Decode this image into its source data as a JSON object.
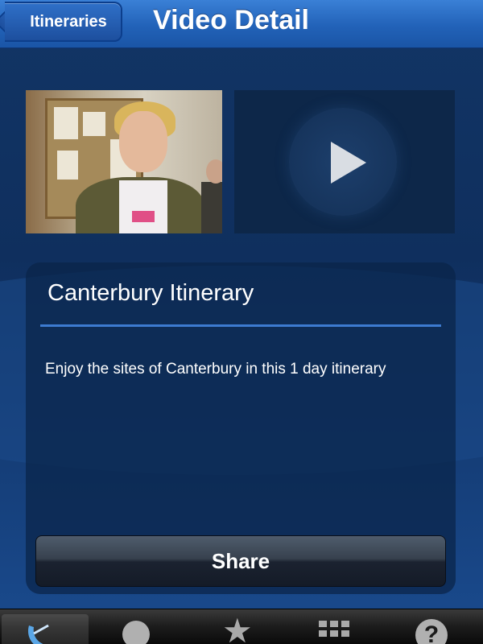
{
  "navbar": {
    "back_label": "Itineraries",
    "title": "Video Detail"
  },
  "video": {
    "thumbnail_icon": "video-thumbnail-image",
    "play_icon": "play-icon"
  },
  "card": {
    "title": "Canterbury Itinerary",
    "description": "Enjoy the sites of Canterbury in this 1 day itinerary",
    "share_label": "Share"
  },
  "tabbar": {
    "tabs": [
      {
        "icon": "satellite-dish-icon",
        "active": true
      },
      {
        "icon": "sun-icon",
        "active": false
      },
      {
        "icon": "star-icon",
        "active": false
      },
      {
        "icon": "grid-icon",
        "active": false
      },
      {
        "icon": "help-icon",
        "active": false
      }
    ],
    "help_glyph": "?"
  },
  "colors": {
    "nav_blue": "#2262b8",
    "background": "#123565",
    "rule_blue": "#3d7bd0"
  }
}
